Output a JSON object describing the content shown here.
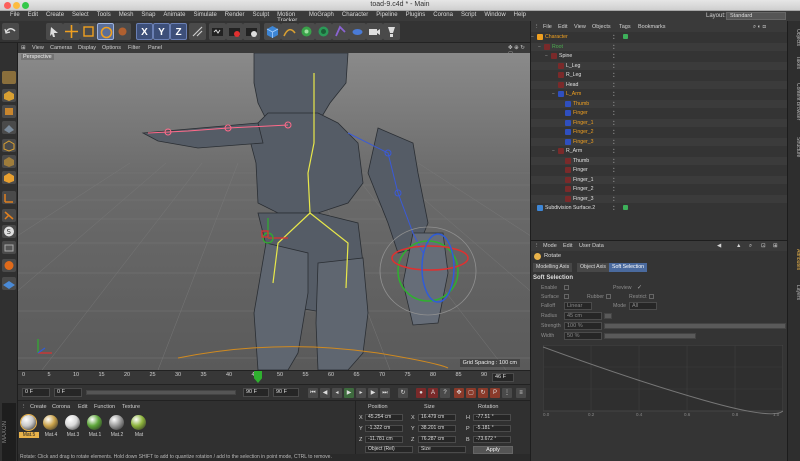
{
  "window": {
    "title": "toad-9.c4d * - Main"
  },
  "menubar": {
    "items": [
      "File",
      "Edit",
      "Create",
      "Select",
      "Tools",
      "Mesh",
      "Snap",
      "Animate",
      "Simulate",
      "Render",
      "Sculpt",
      "Motion Tracker",
      "MoGraph",
      "Character",
      "Pipeline",
      "Plugins",
      "Corona",
      "Script",
      "Window",
      "Help"
    ]
  },
  "layout": {
    "label": "Layout:",
    "value": "Standard"
  },
  "toolbar": {
    "x": "X",
    "y": "Y",
    "z": "Z"
  },
  "viewport": {
    "menu": [
      "View",
      "Cameras",
      "Display",
      "Options",
      "Filter",
      "Panel"
    ],
    "camera_label": "Perspective",
    "grid_spacing": "Grid Spacing : 100 cm"
  },
  "timeline": {
    "ticks": [
      "0",
      "5",
      "10",
      "15",
      "20",
      "25",
      "30",
      "35",
      "40",
      "45",
      "50",
      "55",
      "60",
      "65",
      "70",
      "75",
      "80",
      "85",
      "90"
    ],
    "current_frame": "46",
    "end_label": "46 F"
  },
  "transport": {
    "start": "0 F",
    "min": "0 F",
    "max": "90 F",
    "end": "90 F"
  },
  "materials": {
    "menu": [
      "Create",
      "Corona",
      "Edit",
      "Function",
      "Texture"
    ],
    "items": [
      {
        "name": "Mat.5",
        "color": "#c8c8c8"
      },
      {
        "name": "Mat.4",
        "color": "#c9a24a"
      },
      {
        "name": "Mat.3",
        "color": "#d8d8d8"
      },
      {
        "name": "Mat.1",
        "color": "#5ea63a"
      },
      {
        "name": "Mat.2",
        "color": "#9a9a9a"
      },
      {
        "name": "Mat",
        "color": "#8db43c"
      }
    ]
  },
  "coordinates": {
    "headers": {
      "position": "Position",
      "size": "Size",
      "rotation": "Rotation"
    },
    "rows": [
      {
        "axis": "X",
        "position": "45.254 cm",
        "size_axis": "X",
        "size": "16.479 cm",
        "rot_axis": "H",
        "rotation": "-77.51 °"
      },
      {
        "axis": "Y",
        "position": "-1.322 cm",
        "size_axis": "Y",
        "size": "38.201 cm",
        "rot_axis": "P",
        "rotation": "-5.181 °"
      },
      {
        "axis": "Z",
        "position": "-11.781 cm",
        "size_axis": "Z",
        "size": "76.287 cm",
        "rot_axis": "B",
        "rotation": "-73.672 °"
      }
    ],
    "mode": "Object (Rel)",
    "size_mode": "Size",
    "apply": "Apply"
  },
  "status": "Rotate: Click and drag to rotate elements. Hold down SHIFT to add to quantize rotation / add to the selection in point mode, CTRL to remove.",
  "object_manager": {
    "menu": [
      "File",
      "Edit",
      "View",
      "Objects",
      "Tags",
      "Bookmarks"
    ],
    "items": [
      {
        "name": "Character",
        "indent": 0,
        "color": "#f0a020",
        "icon": "character-icon"
      },
      {
        "name": "Root",
        "indent": 1,
        "color": "#4caf50",
        "icon": "joint-icon"
      },
      {
        "name": "Spine",
        "indent": 2,
        "color": "#e0e0e0",
        "icon": "joint-icon"
      },
      {
        "name": "L_Leg",
        "indent": 3,
        "color": "#e0e0e0",
        "icon": "joint-icon"
      },
      {
        "name": "R_Leg",
        "indent": 3,
        "color": "#e0e0e0",
        "icon": "joint-icon"
      },
      {
        "name": "Head",
        "indent": 3,
        "color": "#e0e0e0",
        "icon": "joint-icon"
      },
      {
        "name": "L_Arm",
        "indent": 3,
        "color": "#f0a020",
        "icon": "joint-icon"
      },
      {
        "name": "Thumb",
        "indent": 4,
        "color": "#f0a020",
        "icon": "joint-icon"
      },
      {
        "name": "Finger",
        "indent": 4,
        "color": "#f0a020",
        "icon": "joint-icon"
      },
      {
        "name": "Finger_1",
        "indent": 4,
        "color": "#f0a020",
        "icon": "joint-icon"
      },
      {
        "name": "Finger_2",
        "indent": 4,
        "color": "#f0a020",
        "icon": "joint-icon"
      },
      {
        "name": "Finger_3",
        "indent": 4,
        "color": "#f0a020",
        "icon": "joint-icon"
      },
      {
        "name": "R_Arm",
        "indent": 3,
        "color": "#e0e0e0",
        "icon": "joint-icon"
      },
      {
        "name": "Thumb",
        "indent": 4,
        "color": "#e0e0e0",
        "icon": "joint-icon"
      },
      {
        "name": "Finger",
        "indent": 4,
        "color": "#e0e0e0",
        "icon": "joint-icon"
      },
      {
        "name": "Finger_1",
        "indent": 4,
        "color": "#e0e0e0",
        "icon": "joint-icon"
      },
      {
        "name": "Finger_2",
        "indent": 4,
        "color": "#e0e0e0",
        "icon": "joint-icon"
      },
      {
        "name": "Finger_3",
        "indent": 4,
        "color": "#e0e0e0",
        "icon": "joint-icon"
      },
      {
        "name": "Subdivision Surface.2",
        "indent": 0,
        "color": "#e0e0e0",
        "icon": "subdivision-icon"
      }
    ]
  },
  "attributes": {
    "menu": [
      "Mode",
      "Edit",
      "User Data"
    ],
    "tool_name": "Rotate",
    "tabs": [
      "Modelling Axis",
      "Object Axis",
      "Soft Selection"
    ],
    "active_tab": "Soft Selection",
    "section": "Soft Selection",
    "fields": {
      "enable": "Enable",
      "preview": "Preview",
      "surface": "Surface",
      "rubber": "Rubber",
      "restrict": "Restrict",
      "falloff": "Falloff",
      "falloff_value": "Linear",
      "mode": "Mode",
      "mode_value": "All",
      "radius": "Radius",
      "radius_value": "45 cm",
      "strength": "Strength",
      "strength_value": "100 %",
      "width": "Width",
      "width_value": "50 %"
    },
    "graph_ticks": [
      "0.0",
      "0.2",
      "0.4",
      "0.6",
      "0.8",
      "1.0"
    ]
  },
  "right_tabs": [
    "Objects",
    "Takes",
    "Content Browser",
    "Structure",
    "Attributes",
    "Layers"
  ]
}
